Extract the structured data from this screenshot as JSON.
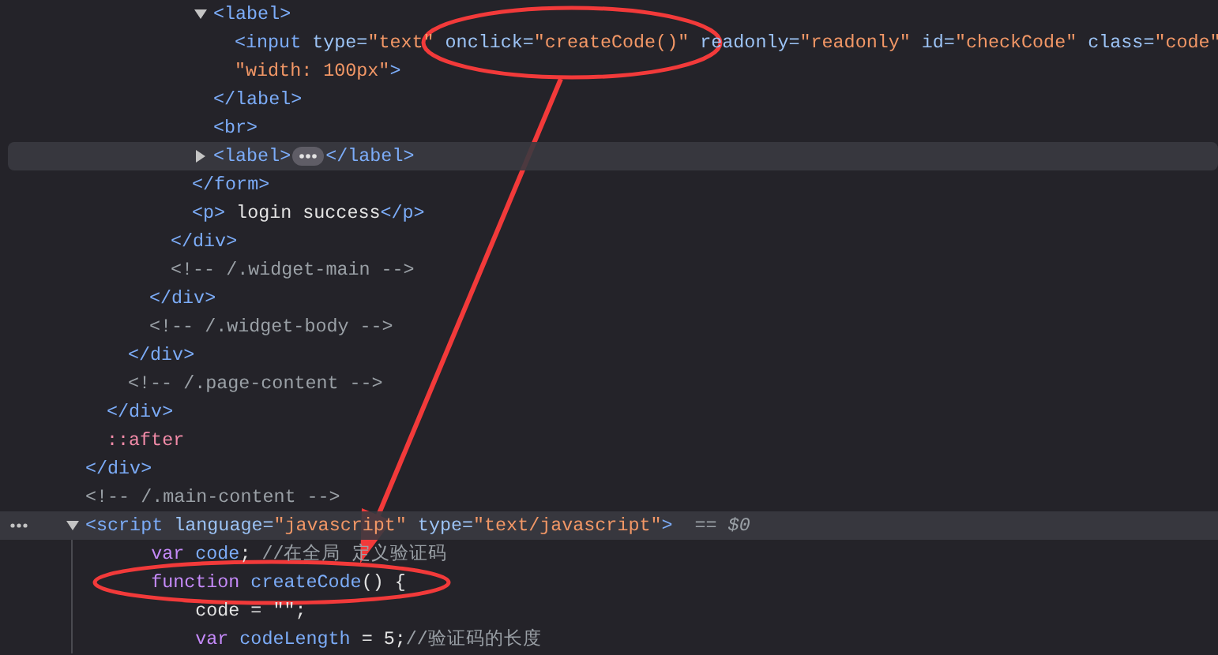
{
  "lines": [
    {
      "children": [
        {
          "children": [
            {
              "children": [
                {
                  "children": [
                    {
                      "children": [
                        {
                          "children": [
                            {
                              "tokens": [
                                {
                                  "kind": "tag",
                                  "text": "<label>"
                                }
                              ],
                              "expanded": true,
                              "selected": false,
                              "hovered": false,
                              "children": [
                                {
                                  "tokens": [
                                    {
                                      "kind": "tag",
                                      "text": "<input"
                                    },
                                    {
                                      "kind": "attr",
                                      "text": " type="
                                    },
                                    {
                                      "kind": "value",
                                      "text": "\"text\""
                                    },
                                    {
                                      "kind": "attr",
                                      "text": " onclick="
                                    },
                                    {
                                      "kind": "value",
                                      "text": "\"createCode()\""
                                    },
                                    {
                                      "kind": "attr",
                                      "text": " readonly="
                                    },
                                    {
                                      "kind": "value",
                                      "text": "\"readonly\""
                                    },
                                    {
                                      "kind": "attr",
                                      "text": " id="
                                    },
                                    {
                                      "kind": "value",
                                      "text": "\"checkCode\""
                                    },
                                    {
                                      "kind": "attr",
                                      "text": " class="
                                    },
                                    {
                                      "kind": "value",
                                      "text": "\"code\""
                                    }
                                  ],
                                  "selected": false,
                                  "hovered": false
                                },
                                {
                                  "tokens": [
                                    {
                                      "kind": "value",
                                      "text": "\"width: 100px\""
                                    },
                                    {
                                      "kind": "tag",
                                      "text": ">"
                                    }
                                  ],
                                  "selected": false,
                                  "hovered": false
                                }
                              ]
                            },
                            {
                              "tokens": [
                                {
                                  "kind": "tag",
                                  "text": "</label>"
                                }
                              ],
                              "selected": false,
                              "hovered": false
                            },
                            {
                              "tokens": [
                                {
                                  "kind": "tag",
                                  "text": "<br>"
                                }
                              ],
                              "selected": false,
                              "hovered": false
                            },
                            {
                              "tokens": [
                                {
                                  "kind": "tag",
                                  "text": "<label>"
                                },
                                {
                                  "kind": "ellipsis"
                                },
                                {
                                  "kind": "tag",
                                  "text": "</label>"
                                }
                              ],
                              "expanded": false,
                              "selected": false,
                              "hovered": true
                            }
                          ]
                        },
                        {
                          "tokens": [
                            {
                              "kind": "tag",
                              "text": "</form>"
                            }
                          ],
                          "selected": false,
                          "hovered": false
                        },
                        {
                          "tokens": [
                            {
                              "kind": "tag",
                              "text": "<p>"
                            },
                            {
                              "kind": "text",
                              "text": " login success"
                            },
                            {
                              "kind": "tag",
                              "text": "</p>"
                            }
                          ],
                          "selected": false,
                          "hovered": false
                        }
                      ]
                    },
                    {
                      "tokens": [
                        {
                          "kind": "tag",
                          "text": "</div>"
                        }
                      ],
                      "selected": false,
                      "hovered": false
                    },
                    {
                      "tokens": [
                        {
                          "kind": "comment",
                          "text": "<!-- /.widget-main -->"
                        }
                      ],
                      "selected": false,
                      "hovered": false
                    }
                  ]
                },
                {
                  "tokens": [
                    {
                      "kind": "tag",
                      "text": "</div>"
                    }
                  ],
                  "selected": false,
                  "hovered": false
                },
                {
                  "tokens": [
                    {
                      "kind": "comment",
                      "text": "<!-- /.widget-body -->"
                    }
                  ],
                  "selected": false,
                  "hovered": false
                }
              ]
            },
            {
              "tokens": [
                {
                  "kind": "tag",
                  "text": "</div>"
                }
              ],
              "selected": false,
              "hovered": false
            },
            {
              "tokens": [
                {
                  "kind": "comment",
                  "text": "<!-- /.page-content -->"
                }
              ],
              "selected": false,
              "hovered": false
            }
          ]
        },
        {
          "tokens": [
            {
              "kind": "tag",
              "text": "</div>"
            }
          ],
          "selected": false,
          "hovered": false
        },
        {
          "tokens": [
            {
              "kind": "pseudo",
              "text": "::after"
            }
          ],
          "selected": false,
          "hovered": false
        }
      ]
    },
    {
      "tokens": [
        {
          "kind": "tag",
          "text": "</div>"
        }
      ],
      "selected": false,
      "hovered": false
    },
    {
      "tokens": [
        {
          "kind": "comment",
          "text": "<!-- /.main-content -->"
        }
      ],
      "selected": false,
      "hovered": false
    },
    {
      "tokens": [
        {
          "kind": "tag",
          "text": "<script"
        },
        {
          "kind": "attr",
          "text": " language="
        },
        {
          "kind": "value",
          "text": "\"javascript\""
        },
        {
          "kind": "attr",
          "text": " type="
        },
        {
          "kind": "value",
          "text": "\"text/javascript\""
        },
        {
          "kind": "tag",
          "text": ">"
        },
        {
          "kind": "reference",
          "text": "== $0"
        }
      ],
      "expanded": true,
      "selected": true,
      "hovered": false,
      "children": [
        {
          "tokens": [
            {
              "kind": "keyword",
              "text": "    var"
            },
            {
              "kind": "ident",
              "text": " code"
            },
            {
              "kind": "text",
              "text": "; "
            },
            {
              "kind": "comment",
              "text": "//在全局 定义验证码"
            }
          ],
          "selected": false,
          "hovered": false
        },
        {
          "tokens": [
            {
              "kind": "keyword",
              "text": "    function"
            },
            {
              "kind": "ident",
              "text": " createCode"
            },
            {
              "kind": "text",
              "text": "() {"
            }
          ],
          "selected": false,
          "hovered": false
        },
        {
          "tokens": [
            {
              "kind": "text",
              "text": "        code = \"\";"
            }
          ],
          "selected": false,
          "hovered": false
        },
        {
          "tokens": [
            {
              "kind": "keyword",
              "text": "        var"
            },
            {
              "kind": "ident",
              "text": " codeLength"
            },
            {
              "kind": "text",
              "text": " = 5;"
            },
            {
              "kind": "comment",
              "text": "//验证码的长度"
            }
          ],
          "selected": false,
          "hovered": false
        }
      ]
    }
  ]
}
